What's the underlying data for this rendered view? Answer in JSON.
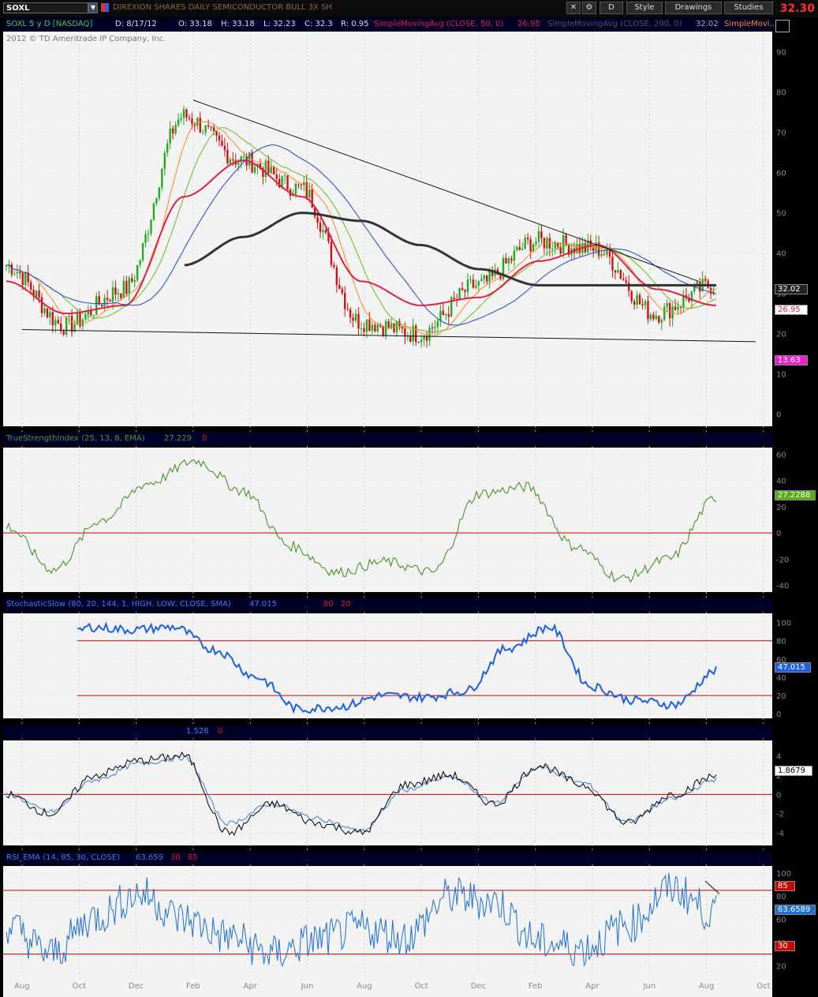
{
  "toolbar": {
    "symbol": "SOXL",
    "company": "DIREXION SHARES DAILY SEMICONDUCTOR BULL 3X SH",
    "period_btn": "D",
    "style_label": "Style",
    "drawings_label": "Drawings",
    "studies_label": "Studies",
    "last_price": "32.30"
  },
  "infobar": {
    "sym": "SOXL 5 y D [NASDAQ]",
    "date": "D: 8/17/12",
    "open": "O: 33.18",
    "high": "H: 33.18",
    "low": "L: 32.23",
    "close": "C: 32.3",
    "range": "R: 0.95",
    "sma50": "SimpleMovingAvg (CLOSE, 50, 0)",
    "sma50_val": "26.95",
    "sma200": "SimpleMovingAvg (CLOSE, 200, 0)",
    "sma200_val": "32.02",
    "sma_more": "SimpleMovi..."
  },
  "copyright": "2012 © TD Ameritrade IP Company, Inc.",
  "x_axis": [
    "Aug",
    "Oct",
    "Dec",
    "Feb",
    "Apr",
    "Jun",
    "Aug",
    "Oct",
    "Dec",
    "Feb",
    "Apr",
    "Jun",
    "Aug",
    "Oct"
  ],
  "colors": {
    "price_up": "#22aa22",
    "price_down": "#cc1111",
    "sma200": "#333333",
    "sma_blue": "#2244cc",
    "sma50": "#dd2244",
    "sma_green": "#66bb22",
    "sma_orange": "#ff8822",
    "tsi": "#3a8a1a",
    "stoch": "#1f5fe0",
    "macd_fast": "#000000",
    "macd_slow": "#3a7fd0",
    "rsi": "#1f6fd0",
    "ref_line": "#cc0000"
  },
  "panes": {
    "price": {
      "y_ticks": [
        "90",
        "80",
        "70",
        "60",
        "50",
        "40",
        "30",
        "20",
        "10",
        "0"
      ],
      "labels": [
        "32.02",
        "26.95",
        "13.63"
      ]
    },
    "tsi": {
      "title": "TrueStrengthIndex (25, 13, 8, EMA)",
      "val": "27.229",
      "zero": "0",
      "y_ticks": [
        "60",
        "40",
        "20",
        "0",
        "-20",
        "-40"
      ],
      "label": "27.2288"
    },
    "stoch": {
      "title": "StochasticSlow (80, 20, 144, 1, HIGH, LOW, CLOSE, SMA)",
      "val": "47.015",
      "ob": "80",
      "os": "20",
      "y_ticks": [
        "100",
        "80",
        "60",
        "40",
        "20",
        "0"
      ],
      "label": "47.015"
    },
    "macd": {
      "val": "1.528",
      "zero": "0",
      "y_ticks": [
        "4",
        "2",
        "0",
        "-2",
        "-4"
      ],
      "label": "1.8679"
    },
    "rsi": {
      "title": "RSI_EMA (14, 85, 30, CLOSE)",
      "val": "63.659",
      "os": "30",
      "ob": "85",
      "y_ticks": [
        "100",
        "80",
        "60",
        "40",
        "20"
      ],
      "labels": [
        "85",
        "63.6589",
        "30"
      ]
    }
  },
  "chart_data": [
    {
      "type": "line",
      "title": "SOXL 5 y D [NASDAQ]",
      "series": [
        {
          "name": "Close",
          "x": [
            "2011-08",
            "2011-10",
            "2011-12",
            "2012-02",
            "2012-04",
            "2012-06",
            "2012-08",
            "2012-10",
            "2012-12",
            "2013-02",
            "2013-04",
            "2013-06",
            "2013-08"
          ],
          "values": [
            37,
            22,
            31,
            74,
            63,
            56,
            23,
            20,
            32,
            43,
            41,
            25,
            32
          ]
        },
        {
          "name": "SimpleMovingAvg (CLOSE, 50, 0)",
          "values": [
            33,
            25,
            27,
            54,
            63,
            54,
            33,
            27,
            29,
            38,
            42,
            31,
            27
          ]
        },
        {
          "name": "SimpleMovingAvg (CLOSE, 200, 0)",
          "values": [
            null,
            null,
            null,
            37,
            44,
            50,
            48,
            42,
            36,
            32,
            32,
            32,
            32
          ]
        }
      ],
      "ylim": [
        0,
        95
      ],
      "trendlines": [
        {
          "from": [
            "2012-02",
            78
          ],
          "to": [
            "2013-08",
            33
          ]
        },
        {
          "from": [
            "2011-08",
            21
          ],
          "to": [
            "2013-10",
            18
          ]
        }
      ]
    },
    {
      "type": "line",
      "title": "TrueStrengthIndex (25, 13, 8, EMA)",
      "series": [
        {
          "name": "TSI",
          "values": [
            5,
            -28,
            10,
            38,
            55,
            32,
            -10,
            -30,
            -22,
            -30,
            30,
            35,
            -10,
            -35,
            -20,
            27
          ]
        }
      ],
      "ylim": [
        -45,
        65
      ]
    },
    {
      "type": "line",
      "title": "StochasticSlow (80, 20, 144, 1, HIGH, LOW, CLOSE, SMA)",
      "series": [
        {
          "name": "SlowK",
          "values": [
            55,
            62,
            95,
            92,
            95,
            70,
            40,
            5,
            8,
            20,
            18,
            25,
            72,
            95,
            30,
            15,
            10,
            47
          ]
        }
      ],
      "ylim": [
        0,
        105
      ]
    },
    {
      "type": "line",
      "series": [
        {
          "name": "fast",
          "values": [
            0,
            -2,
            2,
            3.5,
            4,
            -4,
            -1,
            -3,
            -4,
            1,
            2,
            -1,
            3,
            1,
            -3,
            0,
            1.9
          ]
        },
        {
          "name": "slow",
          "values": [
            0,
            -1.8,
            1.5,
            3.2,
            3.8,
            -3,
            -1,
            -2.5,
            -3.8,
            0.5,
            1.8,
            -0.8,
            2.8,
            1.2,
            -2.8,
            -0.5,
            1.53
          ]
        }
      ],
      "ylim": [
        -5,
        5
      ]
    },
    {
      "type": "line",
      "title": "RSI_EMA (14, 85, 30, CLOSE)",
      "series": [
        {
          "name": "RSI",
          "values": [
            55,
            30,
            62,
            82,
            60,
            45,
            30,
            42,
            52,
            45,
            80,
            75,
            40,
            35,
            55,
            87,
            63.66
          ]
        }
      ],
      "ylim": [
        15,
        105
      ]
    }
  ]
}
